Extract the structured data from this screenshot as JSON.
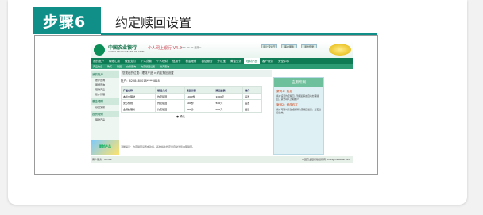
{
  "step": {
    "badge": "步骤6",
    "title": "约定赎回设置"
  },
  "bank": {
    "name": "中国农业银行",
    "sub": "AGRICULTURAL BANK OF CHINA",
    "title": "个人网上银行",
    "version": "V4.0",
    "date": "2014-09-29 星期一",
    "util": [
      "网上营业厅",
      "客户服务",
      "退出登录"
    ]
  },
  "nav": [
    "我的账户",
    "转账汇款",
    "缴费支付",
    "个人贷款",
    "个人理财",
    "信用卡",
    "基金理财",
    "银证服务",
    "外汇宝",
    "黄金业务",
    "理财产品",
    "客户服务",
    "安全中心"
  ],
  "subnav": [
    "产品信息",
    "购买",
    "赎回",
    "交易查询",
    "约定赎回设置",
    "资产查询"
  ],
  "sidebar": {
    "sections": [
      {
        "head": "我的账户",
        "items": [
          "账户查询",
          "明细查询",
          "理财产品",
          "账户管理"
        ]
      },
      {
        "head": "基金理财",
        "items": [
          "基金交易"
        ]
      },
      {
        "head": "投资理财",
        "items": [
          "理财产品"
        ]
      }
    ],
    "promo": "理财产品"
  },
  "main": {
    "crumb": "您现在的位置：理财产品 > 约定赎回设置",
    "account_label": "账户：",
    "account": "6228480018****0818",
    "headers": [
      "产品名称",
      "赎回方式",
      "赎回份额",
      "赎回金额",
      "操作"
    ],
    "rows": [
      {
        "name": "本利丰理财",
        "mode": "约定赎回",
        "share": "1000份",
        "amount": "1000元",
        "op": "设置"
      },
      {
        "name": "安心快线",
        "mode": "约定赎回",
        "share": "500份",
        "amount": "500元",
        "op": "设置"
      },
      {
        "name": "金钥匙理财",
        "mode": "约定赎回",
        "share": "800份",
        "amount": "800元",
        "op": "设置"
      }
    ],
    "confirm": "确认",
    "note": "温馨提示：约定赎回设置成功后，系统将在约定日自动为您办理赎回。"
  },
  "panel": {
    "head": "应用案例",
    "q1": "案例1：约定",
    "a1": "客户设置约定赎回，到期后系统自动办理赎回，资金转入活期账户。",
    "q2": "案例2：修改约定",
    "a2": "客户可随时修改或撤销约定赎回设置，变更当日生效。"
  },
  "footer": {
    "left": "客户服务：95599",
    "right": "中国农业银行版权所有 All Rights Reserved"
  },
  "colors": {
    "accent": "#0f8f87",
    "bank_green": "#0e7b55"
  }
}
